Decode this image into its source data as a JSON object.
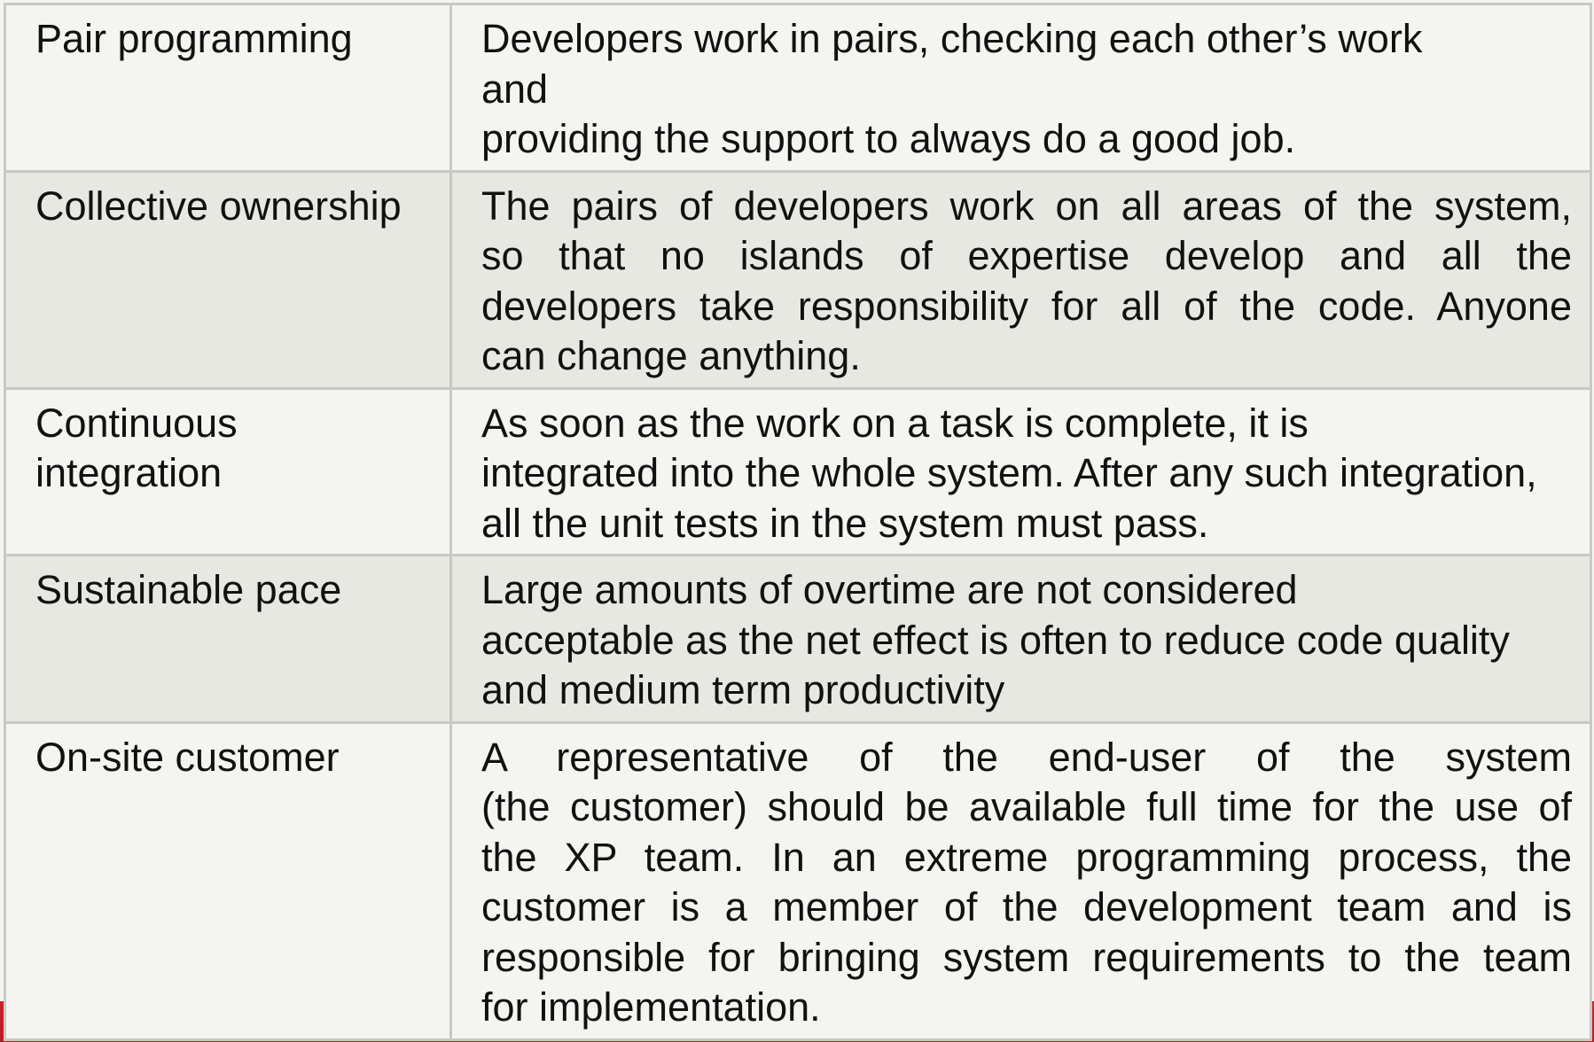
{
  "rows": [
    {
      "term": "Pair programming",
      "lines": [
        "Developers  work  in  pairs,  checking  each  other’s work",
        "and",
        "providing the support to always do a good job."
      ],
      "justified": false
    },
    {
      "term": "Collective ownership",
      "lines": [
        "The pairs of developers work on all areas of the system,",
        "so that no islands of expertise develop and all the",
        "developers take responsibility for all of the code. Anyone",
        "can change anything."
      ],
      "justified": true
    },
    {
      "term": "Continuous integration",
      "lines": [
        "As  soon  as  the work  on a task is  complete,  it is",
        "integrated into the whole system. After any such integration,",
        "all the unit  tests in the system must pass."
      ],
      "justified": false
    },
    {
      "term": "Sustainable pace",
      "lines": [
        "Large amounts of  overtime  are  not  considered",
        "acceptable as the net effect is often to reduce code quality",
        "and medium term productivity"
      ],
      "justified": false
    },
    {
      "term": "On-site customer",
      "lines": [
        "A representative of the end-user of the system",
        "(the customer) should be available full time for the use of",
        "the XP team. In an extreme programming process, the",
        "customer is a member of the development team and is",
        "responsible for bringing system requirements to the team",
        "for implementation."
      ],
      "justified": true
    }
  ]
}
